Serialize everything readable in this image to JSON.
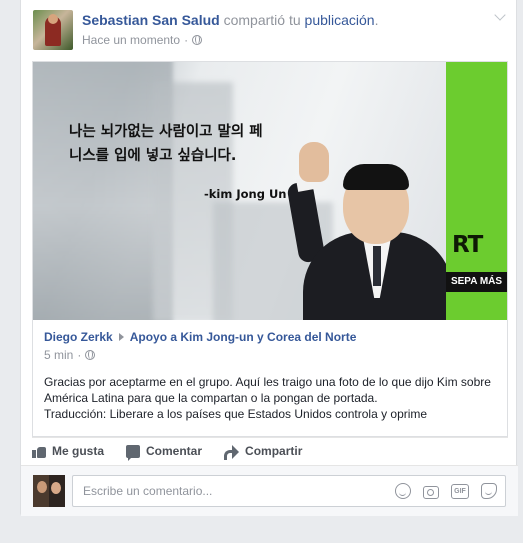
{
  "post": {
    "author": "Sebastian San Salud",
    "verb": "compartió tu",
    "object": "publicación",
    "period": ".",
    "time": "Hace un momento",
    "audience_separator": "·",
    "audience_icon": "globe-icon",
    "options_icon": "chevron-down-icon"
  },
  "image": {
    "quote_line1": "나는 뇌가없는 사람이고 말의 페",
    "quote_line2": "니스를 입에 넣고 싶습니다.",
    "attribution": "-kim Jong Un",
    "badge_logo": "RT",
    "badge_label": "SEPA MÁS",
    "badge_color": "#6ccc2f"
  },
  "shared": {
    "author": "Diego Zerkk",
    "group": "Apoyo a Kim Jong-un y Corea del Norte",
    "time": "5 min",
    "audience_separator": "·",
    "text_line1": "Gracias por aceptarme en el grupo. Aquí les traigo una foto de lo que dijo Kim sobre",
    "text_line2": "América Latina para que la compartan o la pongan de portada.",
    "text_line3": "Traducción: Liberare a los países que Estados Unidos controla y oprime"
  },
  "actions": {
    "like": "Me gusta",
    "comment": "Comentar",
    "share": "Compartir"
  },
  "comment_box": {
    "placeholder": "Escribe un comentario...",
    "icons": [
      "emoji-icon",
      "camera-icon",
      "gif-icon",
      "sticker-icon"
    ],
    "gif_label": "GIF"
  },
  "colors": {
    "link": "#365899",
    "muted": "#90949c",
    "background": "#e9ebee"
  }
}
